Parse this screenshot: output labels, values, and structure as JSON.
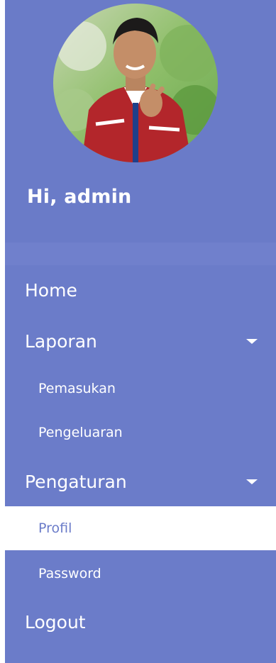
{
  "user": {
    "greeting": "Hi, admin"
  },
  "menu": {
    "home": "Home",
    "laporan": "Laporan",
    "pemasukan": "Pemasukan",
    "pengeluaran": "Pengeluaran",
    "pengaturan": "Pengaturan",
    "profil": "Profil",
    "password": "Password",
    "logout": "Logout"
  },
  "colors": {
    "sidebar": "#6b7cc9",
    "active_bg": "#ffffff",
    "active_text": "#6b7cc9",
    "text": "#ffffff"
  }
}
